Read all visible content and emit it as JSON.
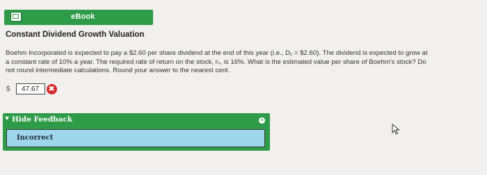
{
  "toolbar": {
    "ebook_label": "eBook",
    "ebook_icon": "book-icon"
  },
  "question": {
    "title": "Constant Dividend Growth Valuation",
    "line1": "Boehm Incorporated is expected to pay a $2.60 per share dividend at the end of this year (i.e., D₁ = $2.60). The dividend is expected to grow at",
    "line2": "a constant rate of 10% a year. The required rate of return on the stock, rₛ, is 16%. What is the estimated value per share of Boehm's stock? Do",
    "line3": "not round intermediate calculations. Round your answer to the nearest cent."
  },
  "answer": {
    "currency": "$",
    "value": "47.67",
    "status_icon": "incorrect-x-icon",
    "status_glyph": "✖"
  },
  "feedback": {
    "toggle_label": "Hide Feedback",
    "message": "Incorrect",
    "close_glyph": "×"
  },
  "colors": {
    "accent_green": "#2e9b48",
    "error_red": "#d42b2b",
    "feedback_blue": "#9fd6ec",
    "background": "#f1f0ee"
  }
}
